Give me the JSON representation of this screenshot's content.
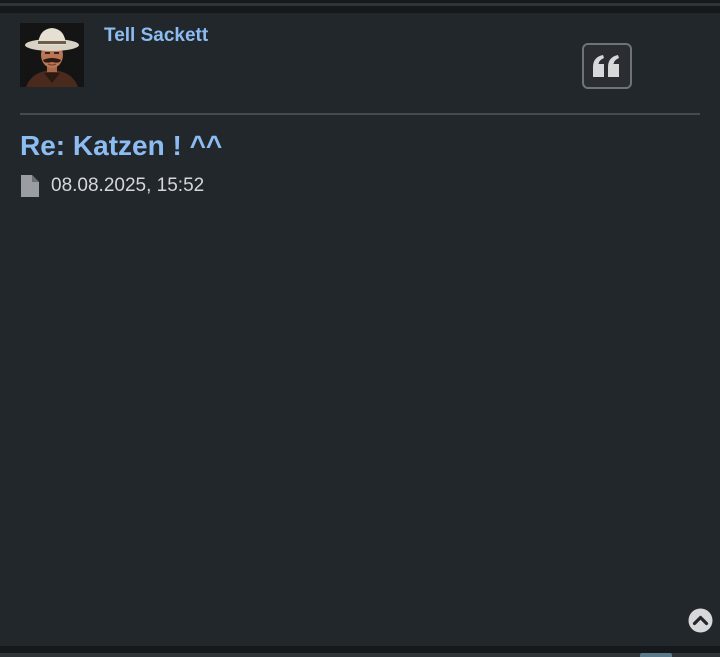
{
  "post": {
    "author": "Tell Sackett",
    "title": "Re: Katzen ! ^^",
    "timestamp": "08.08.2025, 15:52"
  },
  "icons": {
    "quote": "quote-icon",
    "file": "file-icon",
    "scroll_top": "chevron-up-circle-icon"
  },
  "colors": {
    "link": "#8cbcf2",
    "post_background": "#22272b",
    "page_background": "#16191c"
  }
}
